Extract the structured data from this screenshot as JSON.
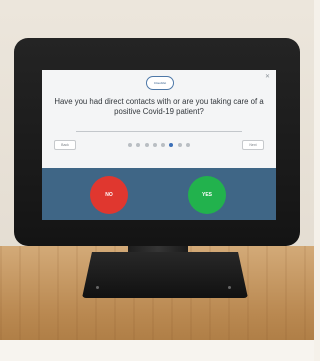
{
  "kiosk_screen": {
    "logo_text": "CloudVet",
    "question": "Have you had direct contacts with or are you taking care of a positive Covid-19 patient?",
    "nav_back_label": "Back",
    "nav_next_label": "Next",
    "no_label": "NO",
    "yes_label": "YES",
    "progress": {
      "current_step": 6,
      "total_steps": 8
    }
  },
  "colors": {
    "no_button": "#e0372f",
    "yes_button": "#22b24d",
    "screen_lower_panel": "#3f6686",
    "kiosk_frame": "#1b1b1b",
    "floor": "#c49563"
  },
  "icons": [
    "close-icon",
    "cloud-logo-icon"
  ]
}
